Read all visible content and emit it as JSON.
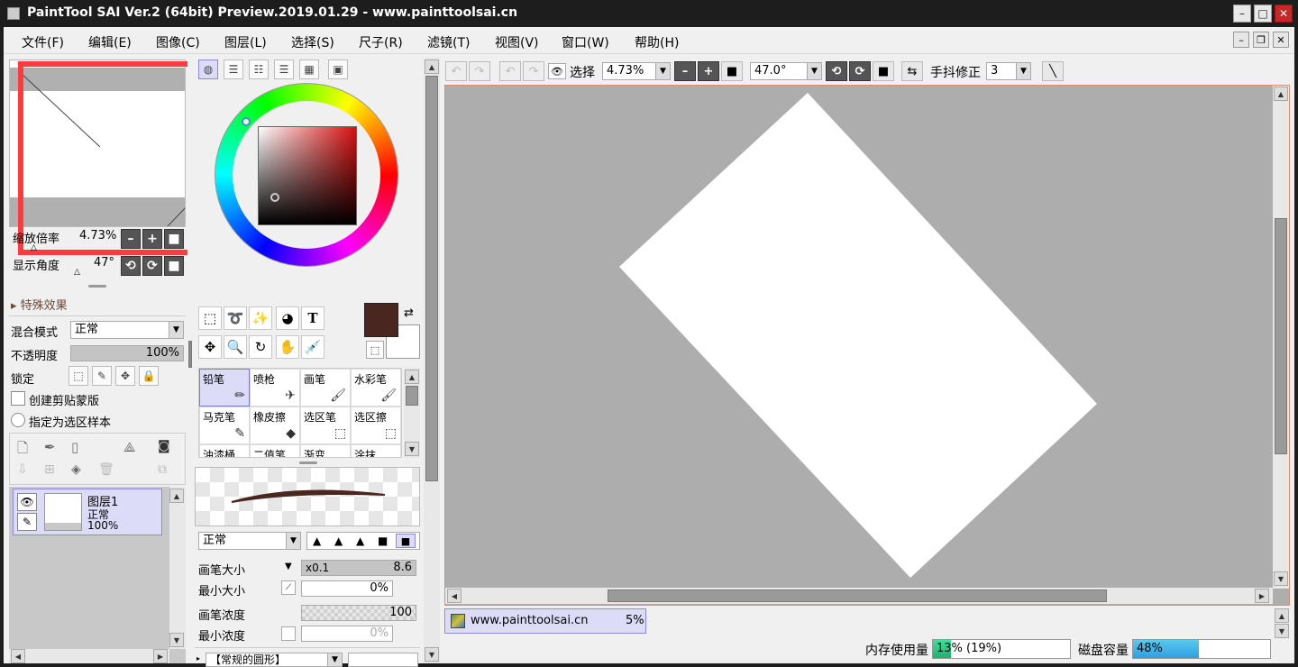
{
  "window": {
    "title": "PaintTool SAI Ver.2 (64bit) Preview.2019.01.29 - www.painttoolsai.cn"
  },
  "menu": [
    "文件(F)",
    "编辑(E)",
    "图像(C)",
    "图层(L)",
    "选择(S)",
    "尺子(R)",
    "滤镜(T)",
    "视图(V)",
    "窗口(W)",
    "帮助(H)"
  ],
  "navigator": {
    "zoom_label": "缩放倍率",
    "zoom_value": "4.73%",
    "angle_label": "显示角度",
    "angle_value": "47°"
  },
  "layer_props": {
    "effects_label": "特殊效果",
    "blend_label": "混合模式",
    "blend_value": "正常",
    "opacity_label": "不透明度",
    "opacity_value": "100%",
    "lock_label": "锁定",
    "clip_label": "创建剪贴蒙版",
    "select_source_label": "指定为选区样本"
  },
  "layer": {
    "name": "图层1",
    "mode": "正常",
    "opacity": "100%"
  },
  "brushes": [
    {
      "label": "铅笔",
      "icon": "pencil-icon",
      "glyph": "✏"
    },
    {
      "label": "喷枪",
      "icon": "airbrush-icon",
      "glyph": "✈"
    },
    {
      "label": "画笔",
      "icon": "brush-icon",
      "glyph": "🖌"
    },
    {
      "label": "水彩笔",
      "icon": "watercolor-icon",
      "glyph": "🖌"
    },
    {
      "label": "马克笔",
      "icon": "marker-icon",
      "glyph": "✎"
    },
    {
      "label": "橡皮擦",
      "icon": "eraser-icon",
      "glyph": "◆"
    },
    {
      "label": "选区笔",
      "icon": "select-pen-icon",
      "glyph": "⬚"
    },
    {
      "label": "选区擦",
      "icon": "select-eraser-icon",
      "glyph": "⬚"
    },
    {
      "label": "油漆桶",
      "icon": "bucket-icon",
      "glyph": ""
    },
    {
      "label": "二值笔",
      "icon": "binary-pen-icon",
      "glyph": ""
    },
    {
      "label": "渐变",
      "icon": "gradient-icon",
      "glyph": ""
    },
    {
      "label": "涂抹",
      "icon": "smudge-icon",
      "glyph": ""
    }
  ],
  "brush_settings": {
    "mode_value": "正常",
    "size_label": "画笔大小",
    "size_multiplier": "x0.1",
    "size_value": "8.6",
    "min_size_label": "最小大小",
    "min_size_value": "0%",
    "density_label": "画笔浓度",
    "density_value": "100",
    "min_density_label": "最小浓度",
    "min_density_value": "0%",
    "shape_label": "【常规的圆形】"
  },
  "toolbar": {
    "select_label": "选择",
    "zoom_value": "4.73%",
    "angle_value": "47.0°",
    "stabilizer_label": "手抖修正",
    "stabilizer_value": "3"
  },
  "doc_tab": {
    "name": "www.painttoolsai.cn",
    "zoom": "5%"
  },
  "status": {
    "memory_label": "内存使用量",
    "memory_value": "13% (19%)",
    "memory_fraction": 0.13,
    "disk_label": "磁盘容量",
    "disk_value": "48%",
    "disk_fraction": 0.48
  },
  "colors": {
    "primary": "#4a2620",
    "secondary": "#ffffff",
    "highlight": "#ff3b3b",
    "canvas_bg": "#adadad"
  }
}
